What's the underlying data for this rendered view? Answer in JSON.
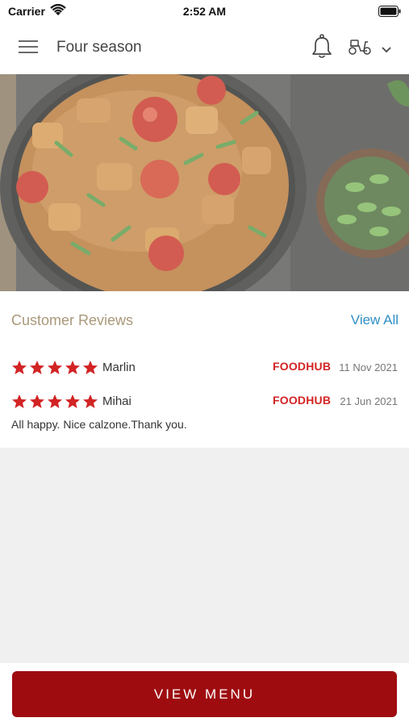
{
  "status_bar": {
    "carrier": "Carrier",
    "time": "2:52 AM"
  },
  "header": {
    "title": "Four season",
    "icons": [
      "menu-icon",
      "bell-icon",
      "scooter-icon",
      "chevron-down-icon"
    ]
  },
  "hero": {
    "image_subject": "food-photo-curry-bowl"
  },
  "reviews": {
    "section_title": "Customer Reviews",
    "view_all_label": "View All",
    "items": [
      {
        "rating": 5,
        "name": "Marlin",
        "source": "FOODHUB",
        "date": "11 Nov 2021",
        "comment": ""
      },
      {
        "rating": 5,
        "name": "Mihai",
        "source": "FOODHUB",
        "date": "21 Jun 2021",
        "comment": "All happy. Nice calzone.Thank you."
      }
    ]
  },
  "bottom": {
    "view_menu_label": "VIEW MENU"
  },
  "colors": {
    "accent": "#9e0c10",
    "star": "#d22424",
    "link": "#2f8fc6",
    "section_title": "#a9987a"
  }
}
